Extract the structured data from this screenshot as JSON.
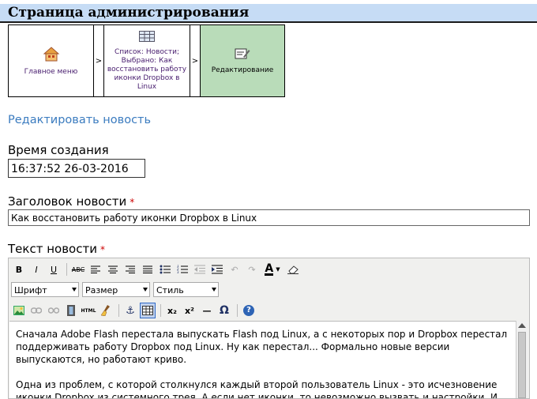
{
  "header": {
    "title": "Страница администрирования"
  },
  "breadcrumb": {
    "items": [
      {
        "label": "Главное меню",
        "icon": "home-icon"
      },
      {
        "label": "Список: Новости; Выбрано: Как восстановить работу иконки Dropbox в Linux",
        "icon": "table-icon"
      },
      {
        "label": "Редактирование",
        "icon": "edit-icon"
      }
    ],
    "separator": ">"
  },
  "section": {
    "edit_link": "Редактировать новость"
  },
  "fields": {
    "time_label": "Время создания",
    "time_value": "16:37:52 26-03-2016",
    "title_label": "Заголовок новости",
    "title_value": "Как восстановить работу иконки Dropbox в Linux",
    "text_label": "Текст новости",
    "required_mark": "*"
  },
  "editor": {
    "toolbar": {
      "bold": "B",
      "italic": "I",
      "underline": "U",
      "strike": "ABC",
      "html": "HTML",
      "subscript": "x₂",
      "superscript": "x²",
      "hr": "—",
      "omega": "Ω",
      "help": "?",
      "font_color": "A"
    },
    "selects": {
      "font": "Шрифт",
      "size": "Размер",
      "style": "Стиль"
    },
    "content": [
      "Сначала Adobe Flash перестала выпускать Flash под Linux, а с некоторых пор и Dropbox перестал поддерживать работу Dropbox под Linux. Ну как перестал... Формально новые версии выпускаются, но работают криво.",
      "Одна из проблем, с которой столкнулся каждый второй пользователь Linux - это исчезновение иконки Dropbox из системного трея. А если нет иконки, то невозможно вызвать и настройки. И"
    ]
  },
  "colors": {
    "header_bg": "#c6dcf5",
    "active_crumb": "#b9dcb9",
    "link": "#3a7bbf",
    "required": "#cc0000"
  }
}
